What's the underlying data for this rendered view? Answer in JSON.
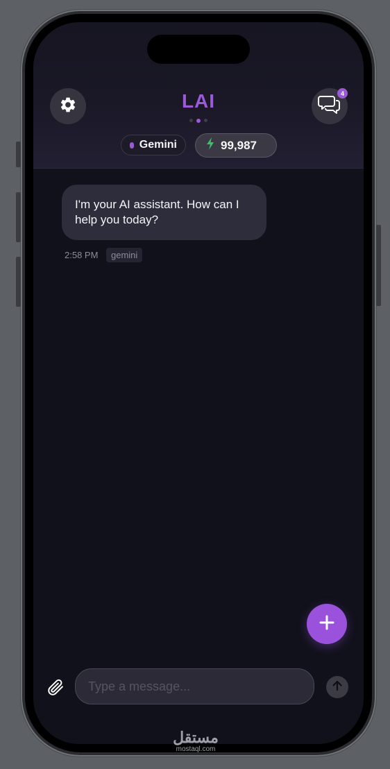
{
  "header": {
    "app_title": "LAI",
    "page_dots": 3,
    "active_dot": 1,
    "chats_badge": "4",
    "model_pill": "Gemini",
    "credits": "99,987"
  },
  "conversation": {
    "messages": [
      {
        "text": "I'm your AI assistant. How can I help you today?",
        "time": "2:58 PM",
        "model_tag": "gemini"
      }
    ]
  },
  "composer": {
    "placeholder": "Type a message..."
  },
  "watermark": {
    "arabic": "مستقل",
    "latin": "mostaql.com"
  },
  "colors": {
    "accent": "#9a52dc",
    "background": "#11111b",
    "bubble": "#2e2d3b"
  },
  "icons": [
    "gear-icon",
    "chat-bubbles-icon",
    "bolt-icon",
    "plus-icon",
    "paperclip-icon",
    "arrow-up-icon"
  ]
}
